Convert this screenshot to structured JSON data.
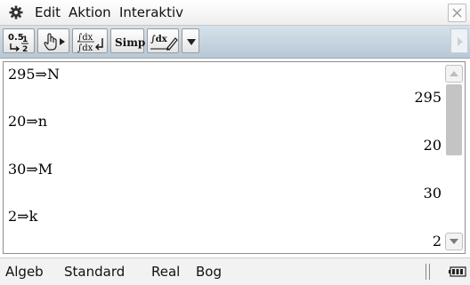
{
  "menubar": {
    "icon": "gear-icon",
    "items": [
      "Edit",
      "Aktion",
      "Interaktiv"
    ],
    "close_icon": "close-icon"
  },
  "toolbar": {
    "buttons": [
      {
        "icon": "decimal-fraction-toggle-icon",
        "text_top": "0.5",
        "text_bottom": "1/2"
      },
      {
        "icon": "hand-pointer-play-icon"
      },
      {
        "icon": "integral-approx-icon",
        "text_top": "∫dx",
        "text_bottom": "∫dx"
      },
      {
        "icon": "simplify-icon",
        "label": "Simp"
      },
      {
        "icon": "integral-pen-icon",
        "label": "∫dx"
      },
      {
        "icon": "dropdown-arrow-icon"
      }
    ],
    "right_scroll_icon": "scroll-right-arrow-icon"
  },
  "main": {
    "entries": [
      {
        "input": "295⇒N",
        "output": "295"
      },
      {
        "input": "20⇒n",
        "output": "20"
      },
      {
        "input": "30⇒M",
        "output": "30"
      },
      {
        "input": "2⇒k",
        "output": "2"
      }
    ]
  },
  "statusbar": {
    "items": [
      "Algeb",
      "Standard",
      "Real",
      "Bog"
    ],
    "battery_icon": "battery-icon"
  },
  "colors": {
    "toolbar_top": "#d6e1ea",
    "toolbar_bottom": "#b7c8d6",
    "scroll_thumb": "#c4c4c4"
  }
}
